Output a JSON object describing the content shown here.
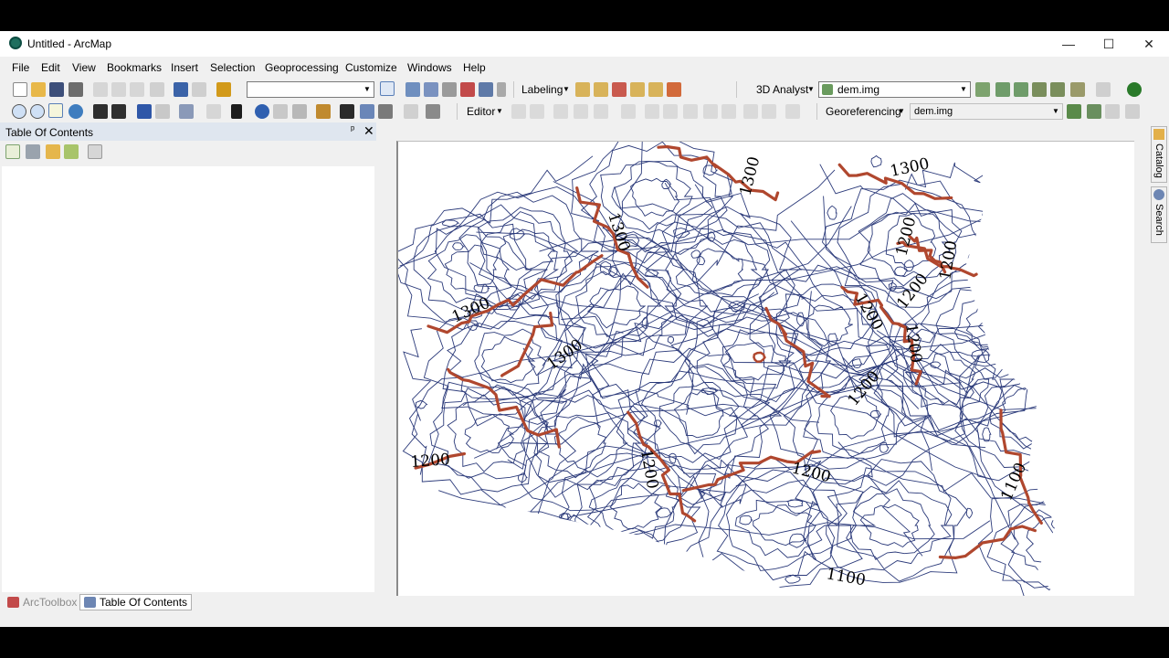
{
  "window": {
    "title": "Untitled - ArcMap",
    "minimize": "—",
    "maximize": "☐",
    "close": "✕"
  },
  "menu": [
    "File",
    "Edit",
    "View",
    "Bookmarks",
    "Insert",
    "Selection",
    "Geoprocessing",
    "Customize",
    "Windows",
    "Help"
  ],
  "toolbar": {
    "scale_value": "",
    "labeling_label": "Labeling",
    "analyst_label": "3D Analyst",
    "analyst_layer": "dem.img",
    "editor_label": "Editor",
    "georef_label": "Georeferencing",
    "georef_layer": "dem.img"
  },
  "toc": {
    "title": "Table Of Contents",
    "pin": "ᵖ",
    "close": "✕"
  },
  "bottom_tabs": {
    "arctoolbox": "ArcToolbox",
    "toc": "Table Of Contents"
  },
  "right_dock": {
    "catalog": "Catalog",
    "search": "Search"
  },
  "map": {
    "index_color": "#b0472e",
    "contour_color": "#2b3a7a",
    "labels": [
      "1300",
      "1300",
      "1300",
      "1300",
      "1300",
      "1200",
      "1200",
      "1200",
      "1200",
      "1200",
      "1200",
      "1200",
      "1200",
      "1200",
      "1100",
      "1100"
    ]
  }
}
